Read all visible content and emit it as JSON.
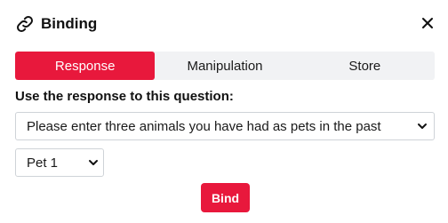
{
  "dialog": {
    "title": "Binding",
    "title_icon": "link-icon",
    "close_icon": "close-icon"
  },
  "tabs": [
    {
      "label": "Response",
      "active": true
    },
    {
      "label": "Manipulation",
      "active": false
    },
    {
      "label": "Store",
      "active": false
    }
  ],
  "question": {
    "label": "Use the response to this question:",
    "selected": "Please enter three animals you have had as pets in the past"
  },
  "pet": {
    "selected": "Pet 1"
  },
  "bind_button": {
    "label": "Bind"
  },
  "colors": {
    "accent": "#e8183c",
    "tab_background": "#f1f2f4",
    "border": "#cfd3d8"
  },
  "icons": {
    "dropdown": "chevron-down-icon"
  }
}
